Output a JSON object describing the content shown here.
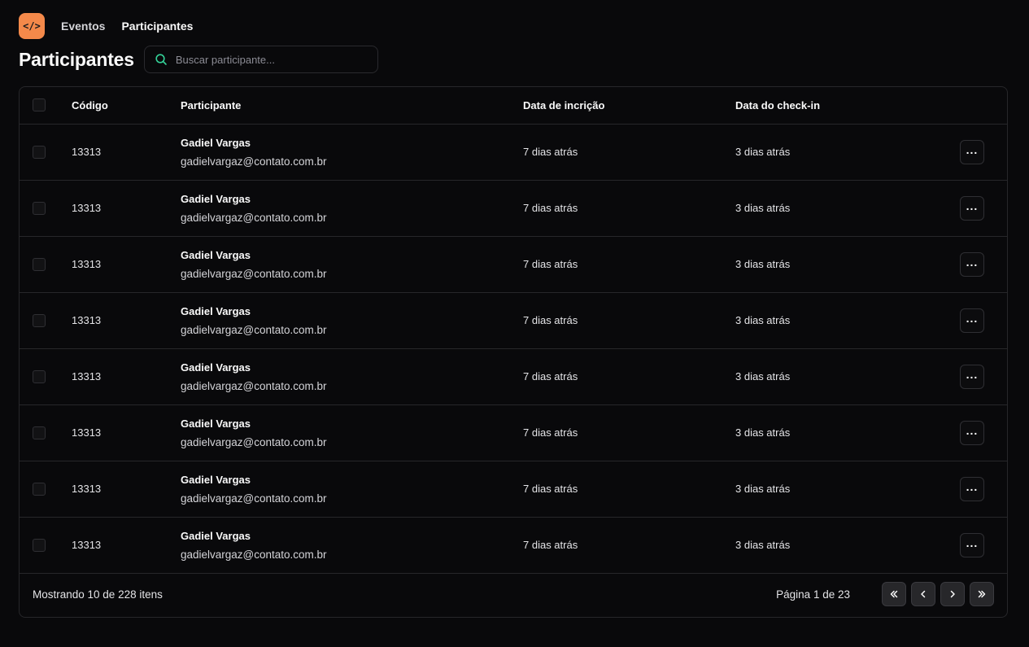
{
  "nav": {
    "logo_text": "</>",
    "links": [
      "Eventos",
      "Participantes"
    ]
  },
  "header": {
    "title": "Participantes",
    "search_placeholder": "Buscar participante..."
  },
  "table": {
    "columns": [
      "Código",
      "Participante",
      "Data de incrição",
      "Data do check-in"
    ],
    "rows": [
      {
        "code": "13313",
        "name": "Gadiel Vargas",
        "email": "gadielvargaz@contato.com.br",
        "created": "7 dias atrás",
        "checkin": "3 dias atrás"
      },
      {
        "code": "13313",
        "name": "Gadiel Vargas",
        "email": "gadielvargaz@contato.com.br",
        "created": "7 dias atrás",
        "checkin": "3 dias atrás"
      },
      {
        "code": "13313",
        "name": "Gadiel Vargas",
        "email": "gadielvargaz@contato.com.br",
        "created": "7 dias atrás",
        "checkin": "3 dias atrás"
      },
      {
        "code": "13313",
        "name": "Gadiel Vargas",
        "email": "gadielvargaz@contato.com.br",
        "created": "7 dias atrás",
        "checkin": "3 dias atrás"
      },
      {
        "code": "13313",
        "name": "Gadiel Vargas",
        "email": "gadielvargaz@contato.com.br",
        "created": "7 dias atrás",
        "checkin": "3 dias atrás"
      },
      {
        "code": "13313",
        "name": "Gadiel Vargas",
        "email": "gadielvargaz@contato.com.br",
        "created": "7 dias atrás",
        "checkin": "3 dias atrás"
      },
      {
        "code": "13313",
        "name": "Gadiel Vargas",
        "email": "gadielvargaz@contato.com.br",
        "created": "7 dias atrás",
        "checkin": "3 dias atrás"
      },
      {
        "code": "13313",
        "name": "Gadiel Vargas",
        "email": "gadielvargaz@contato.com.br",
        "created": "7 dias atrás",
        "checkin": "3 dias atrás"
      }
    ],
    "row_action_icon": "more-horizontal-icon"
  },
  "footer": {
    "showing": "Mostrando 10 de 228 itens",
    "page": "Página 1 de 23"
  },
  "colors": {
    "background": "#09090b",
    "accent": "#f4894a",
    "border": "#27272a",
    "search_icon": "#34d399"
  }
}
